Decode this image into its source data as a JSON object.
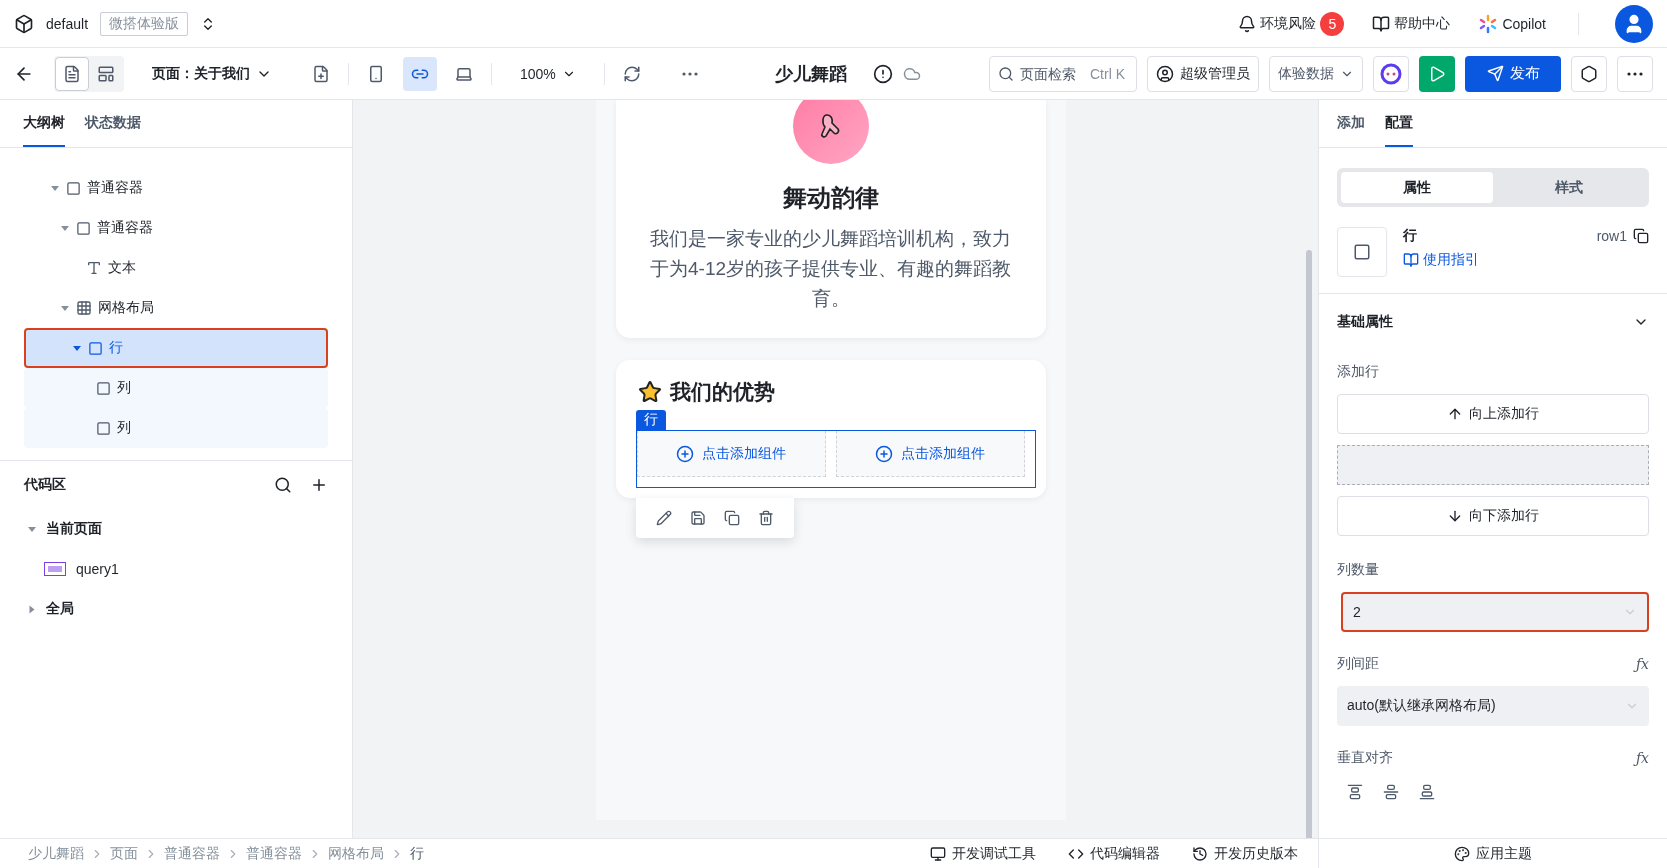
{
  "topbar": {
    "app_name": "default",
    "edition": "微搭体验版",
    "risk": {
      "label": "环境风险",
      "count": "5"
    },
    "help": "帮助中心",
    "copilot": "Copilot"
  },
  "toolbar": {
    "views": [
      {
        "kind": "page",
        "selected": true
      },
      {
        "kind": "layout",
        "selected": false
      }
    ],
    "page_label": "页面：关于我们",
    "devices": [
      {
        "kind": "mobile",
        "selected": false
      },
      {
        "kind": "miniprogram",
        "selected": true
      },
      {
        "kind": "desktop",
        "selected": false
      }
    ],
    "zoom": "100%",
    "title": "少儿舞蹈",
    "search": {
      "placeholder": "页面检索",
      "shortcut": "Ctrl K"
    },
    "user": "超级管理员",
    "data_select": "体验数据",
    "publish": "发布"
  },
  "left": {
    "tabs": [
      {
        "label": "大纲树",
        "selected": true
      },
      {
        "label": "状态数据",
        "selected": false
      }
    ],
    "outline": [
      {
        "label": "普通容器",
        "kind": "container",
        "expanded": true,
        "selected": false,
        "children": [
          {
            "label": "普通容器",
            "kind": "container",
            "expanded": true,
            "selected": false,
            "children": [
              {
                "label": "文本",
                "kind": "text",
                "selected": false
              }
            ]
          },
          {
            "label": "网格布局",
            "kind": "grid",
            "expanded": true,
            "selected": false,
            "children": [
              {
                "label": "行",
                "kind": "container",
                "expanded": true,
                "selected": true,
                "children": [
                  {
                    "label": "列",
                    "kind": "container",
                    "selected": false
                  },
                  {
                    "label": "列",
                    "kind": "container",
                    "selected": false
                  }
                ]
              }
            ]
          }
        ]
      }
    ],
    "code_area": {
      "title": "代码区",
      "groups": [
        {
          "label": "当前页面",
          "expanded": true,
          "children": [
            {
              "label": "query1",
              "kind": "api"
            }
          ]
        },
        {
          "label": "全局",
          "expanded": false
        }
      ]
    }
  },
  "canvas": {
    "hero": {
      "title": "舞动韵律",
      "description": "我们是一家专业的少儿舞蹈培训机构，致力于为4-12岁的孩子提供专业、有趣的舞蹈教育。"
    },
    "section": {
      "title": "我们的优势",
      "row_tag": "行",
      "columns": [
        {
          "label": "点击添加组件"
        },
        {
          "label": "点击添加组件"
        }
      ]
    }
  },
  "right": {
    "tabs": [
      {
        "label": "添加",
        "selected": false
      },
      {
        "label": "配置",
        "selected": true
      }
    ],
    "segments": [
      {
        "label": "属性",
        "selected": true
      },
      {
        "label": "样式",
        "selected": false
      }
    ],
    "component": {
      "name": "行",
      "guide": "使用指引",
      "id": "row1"
    },
    "section": "基础属性",
    "add_row": {
      "label": "添加行",
      "up": "向上添加行",
      "down": "向下添加行"
    },
    "column_count": {
      "label": "列数量",
      "value": "2"
    },
    "gap": {
      "label": "列间距",
      "formula": "ƒx",
      "value": "auto(默认继承网格布局)"
    },
    "valign": {
      "label": "垂直对齐",
      "formula": "ƒx"
    },
    "theme": "应用主题"
  },
  "status_bar": {
    "breadcrumbs": [
      "少儿舞蹈",
      "页面",
      "普通容器",
      "普通容器",
      "网格布局",
      "行"
    ],
    "tools": [
      {
        "kind": "debug",
        "label": "开发调试工具"
      },
      {
        "kind": "code",
        "label": "代码编辑器"
      },
      {
        "kind": "history",
        "label": "开发历史版本"
      }
    ]
  }
}
